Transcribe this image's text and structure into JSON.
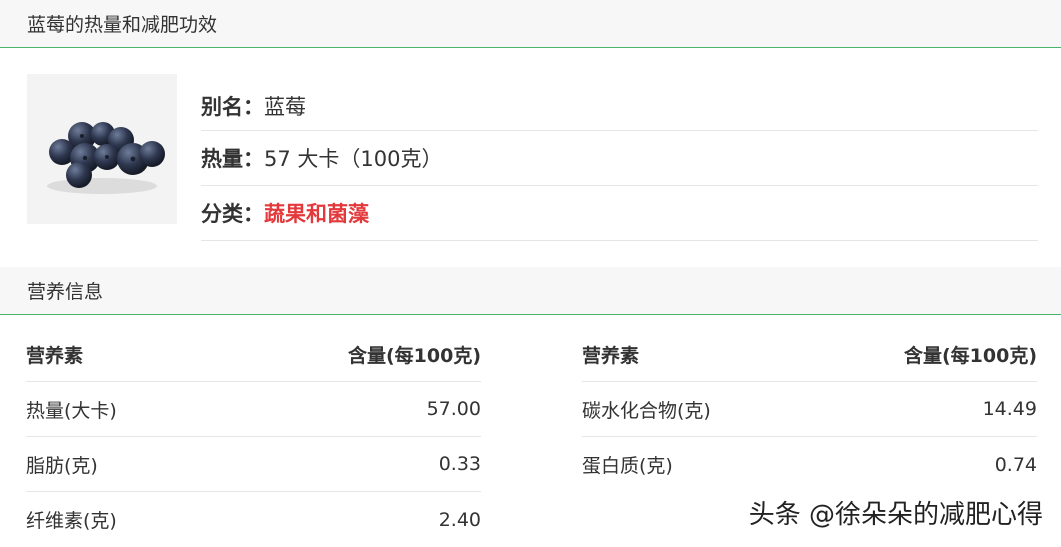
{
  "header": {
    "title": "蓝莓的热量和减肥功效"
  },
  "food": {
    "alias_label": "别名：",
    "alias_value": "蓝莓",
    "calories_label": "热量：",
    "calories_value": "57 大卡（100克）",
    "category_label": "分类：",
    "category_value": "蔬果和菌藻",
    "category_color": "#e4393c"
  },
  "nutrition": {
    "title": "营养信息",
    "col_nutrient": "营养素",
    "col_amount": "含量(每100克)",
    "left": [
      {
        "name": "热量(大卡)",
        "value": "57.00"
      },
      {
        "name": "脂肪(克)",
        "value": "0.33"
      },
      {
        "name": "纤维素(克)",
        "value": "2.40"
      }
    ],
    "right": [
      {
        "name": "碳水化合物(克)",
        "value": "14.49"
      },
      {
        "name": "蛋白质(克)",
        "value": "0.74"
      }
    ]
  },
  "watermark": "头条 @徐朵朵的减肥心得",
  "icons": {
    "food_image": "blueberries-image"
  },
  "colors": {
    "accent_line": "#49b36b"
  }
}
